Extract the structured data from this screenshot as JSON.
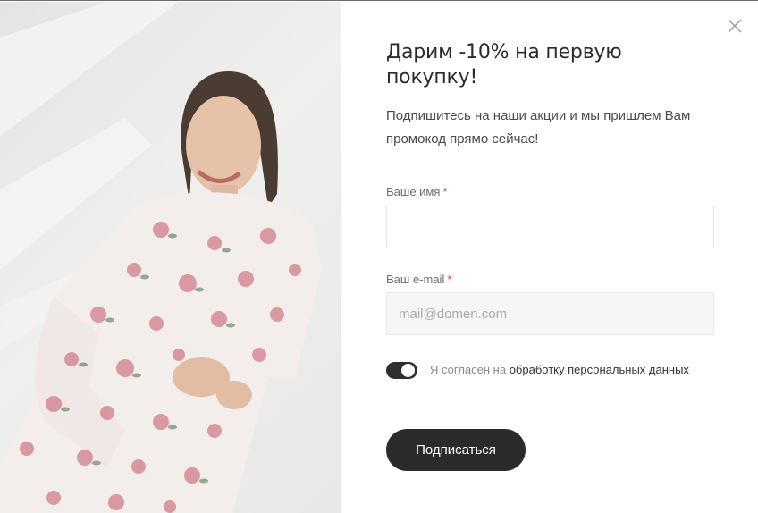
{
  "popup": {
    "title": "Дарим -10% на первую покупку!",
    "description": "Подпишитесь на наши акции и мы пришлем Вам промокод прямо сейчас!",
    "form": {
      "name_label": "Ваше имя",
      "name_value": "",
      "email_label": "Ваш e-mail",
      "email_placeholder": "mail@domen.com",
      "required_mark": "*",
      "consent_prefix": "Я согласен на",
      "consent_link": "обработку персональных данных",
      "consent_checked": true,
      "submit_label": "Подписаться"
    },
    "icons": {
      "close": "close-icon"
    },
    "colors": {
      "accent": "#2b2b2b",
      "required": "#e0433a",
      "input_disabled_bg": "#f6f6f6"
    }
  }
}
